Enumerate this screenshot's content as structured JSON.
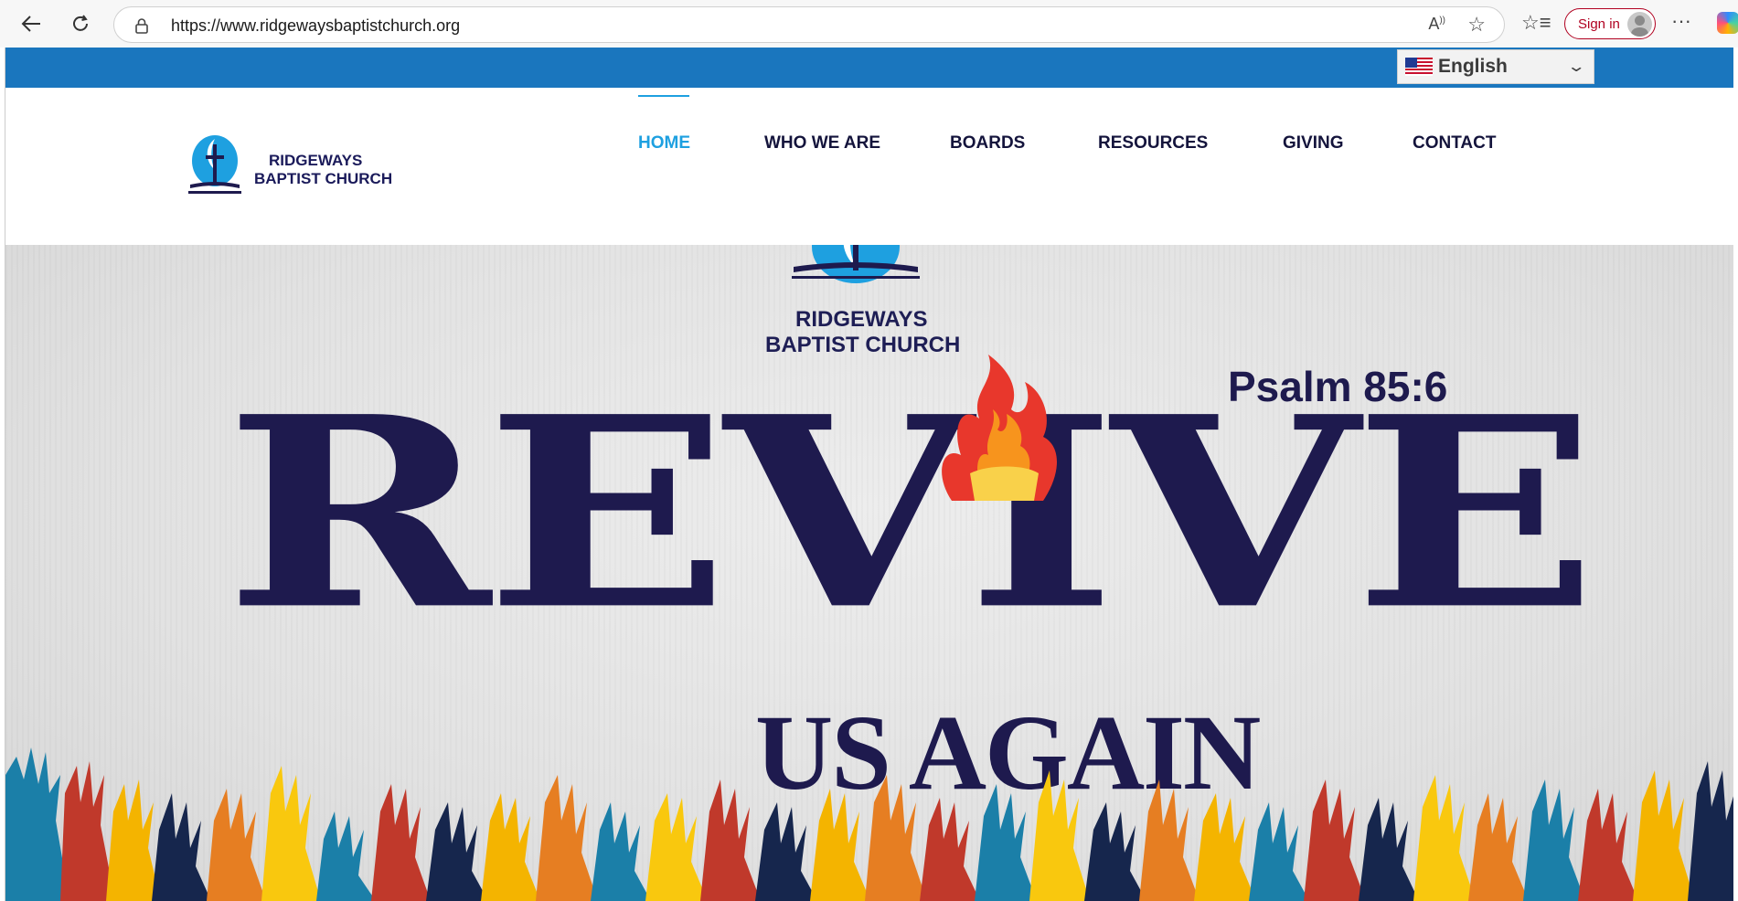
{
  "browser": {
    "url": "https://www.ridgewaysbaptistchurch.org",
    "signin_label": "Sign in",
    "icons": [
      "back-arrow-icon",
      "refresh-icon",
      "lock-icon",
      "read-aloud-icon",
      "favorite-star-icon",
      "favorites-icon",
      "profile-avatar-icon",
      "more-icon",
      "copilot-icon"
    ]
  },
  "language": {
    "selected": "English",
    "flag": "us-flag-icon"
  },
  "logo": {
    "line1": "RIDGEWAYS",
    "line2": "BAPTIST CHURCH"
  },
  "menu": {
    "items": [
      {
        "label": "HOME",
        "active": true
      },
      {
        "label": "WHO WE ARE",
        "active": false
      },
      {
        "label": "BOARDS",
        "active": false
      },
      {
        "label": "RESOURCES",
        "active": false
      },
      {
        "label": "GIVING",
        "active": false
      },
      {
        "label": "CONTACT",
        "active": false
      }
    ]
  },
  "hero": {
    "church_line1": "RIDGEWAYS",
    "church_line2": "BAPTIST CHURCH",
    "verse": "Psalm 85:6",
    "headline": "REVIVE",
    "subheadline": "US AGAIN"
  },
  "colors": {
    "topbar": "#1a76be",
    "accent": "#1ea0e0",
    "navy": "#1e1a4e"
  }
}
